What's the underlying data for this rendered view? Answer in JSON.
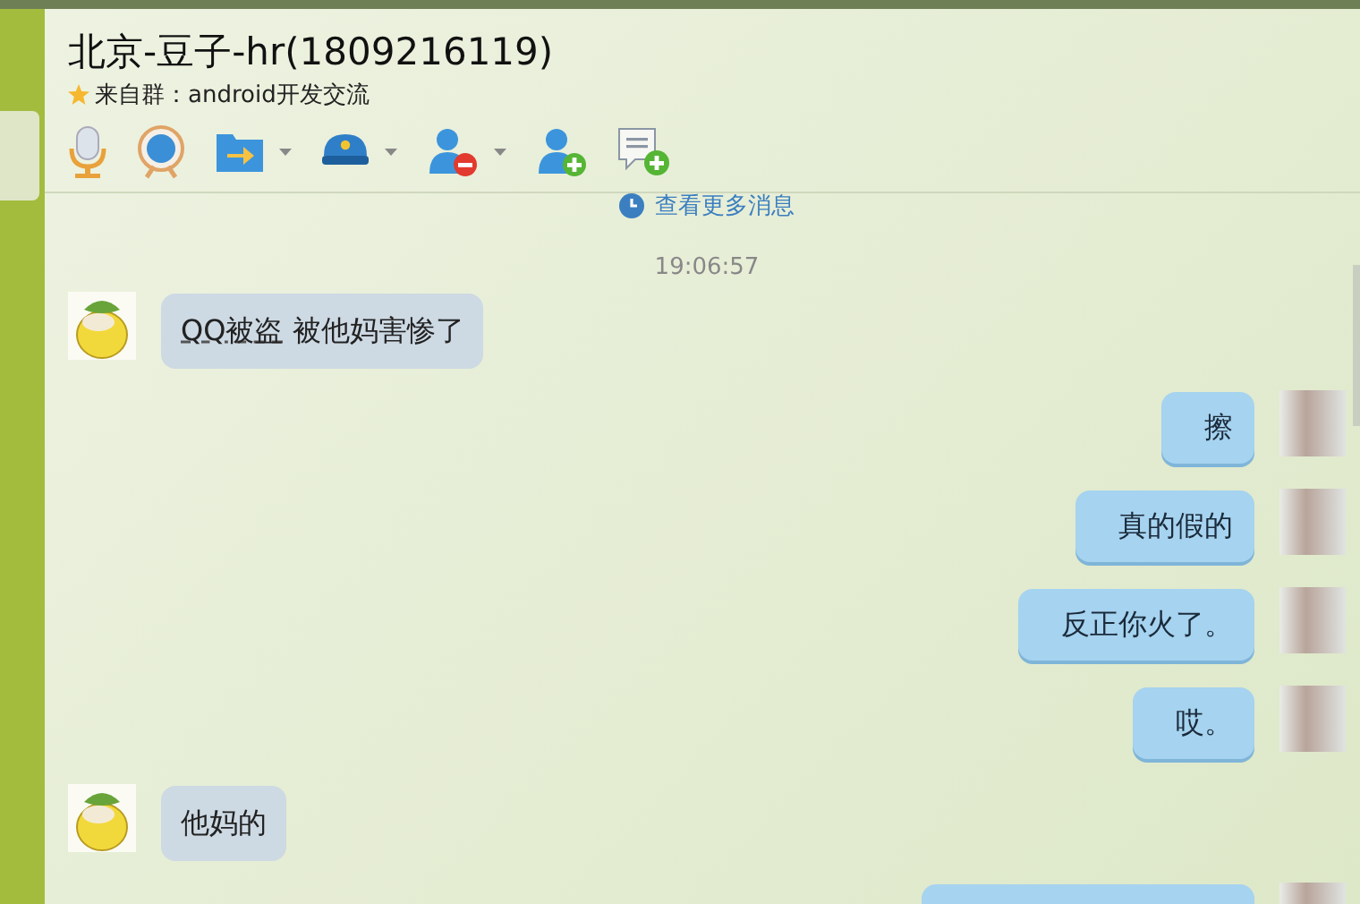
{
  "header": {
    "title": "北京-豆子-hr(1809216119)",
    "subtitle": "来自群：android开发交流"
  },
  "toolbar": [
    {
      "kind": "mic",
      "dropdown": false
    },
    {
      "kind": "camera",
      "dropdown": false
    },
    {
      "kind": "folder",
      "dropdown": true
    },
    {
      "kind": "police",
      "dropdown": true
    },
    {
      "kind": "user-remove",
      "dropdown": true
    },
    {
      "kind": "user-add",
      "dropdown": false
    },
    {
      "kind": "note-add",
      "dropdown": false
    }
  ],
  "more_link": "查看更多消息",
  "timestamp": "19:06:57",
  "messages": [
    {
      "kind": "incoming",
      "parts": [
        {
          "text": "QQ被盗",
          "underlined": true
        },
        {
          "text": " 被他妈害惨了",
          "underlined": false
        }
      ]
    },
    {
      "kind": "outgoing",
      "parts": [
        {
          "text": "擦",
          "underlined": false
        }
      ]
    },
    {
      "kind": "outgoing",
      "parts": [
        {
          "text": "真的假的",
          "underlined": false
        }
      ]
    },
    {
      "kind": "outgoing",
      "parts": [
        {
          "text": "反正你火了。",
          "underlined": false
        }
      ]
    },
    {
      "kind": "outgoing",
      "parts": [
        {
          "text": "哎。",
          "underlined": false
        }
      ]
    },
    {
      "kind": "incoming",
      "parts": [
        {
          "text": "他妈的",
          "underlined": false
        }
      ]
    },
    {
      "kind": "outgoing-cut"
    }
  ]
}
